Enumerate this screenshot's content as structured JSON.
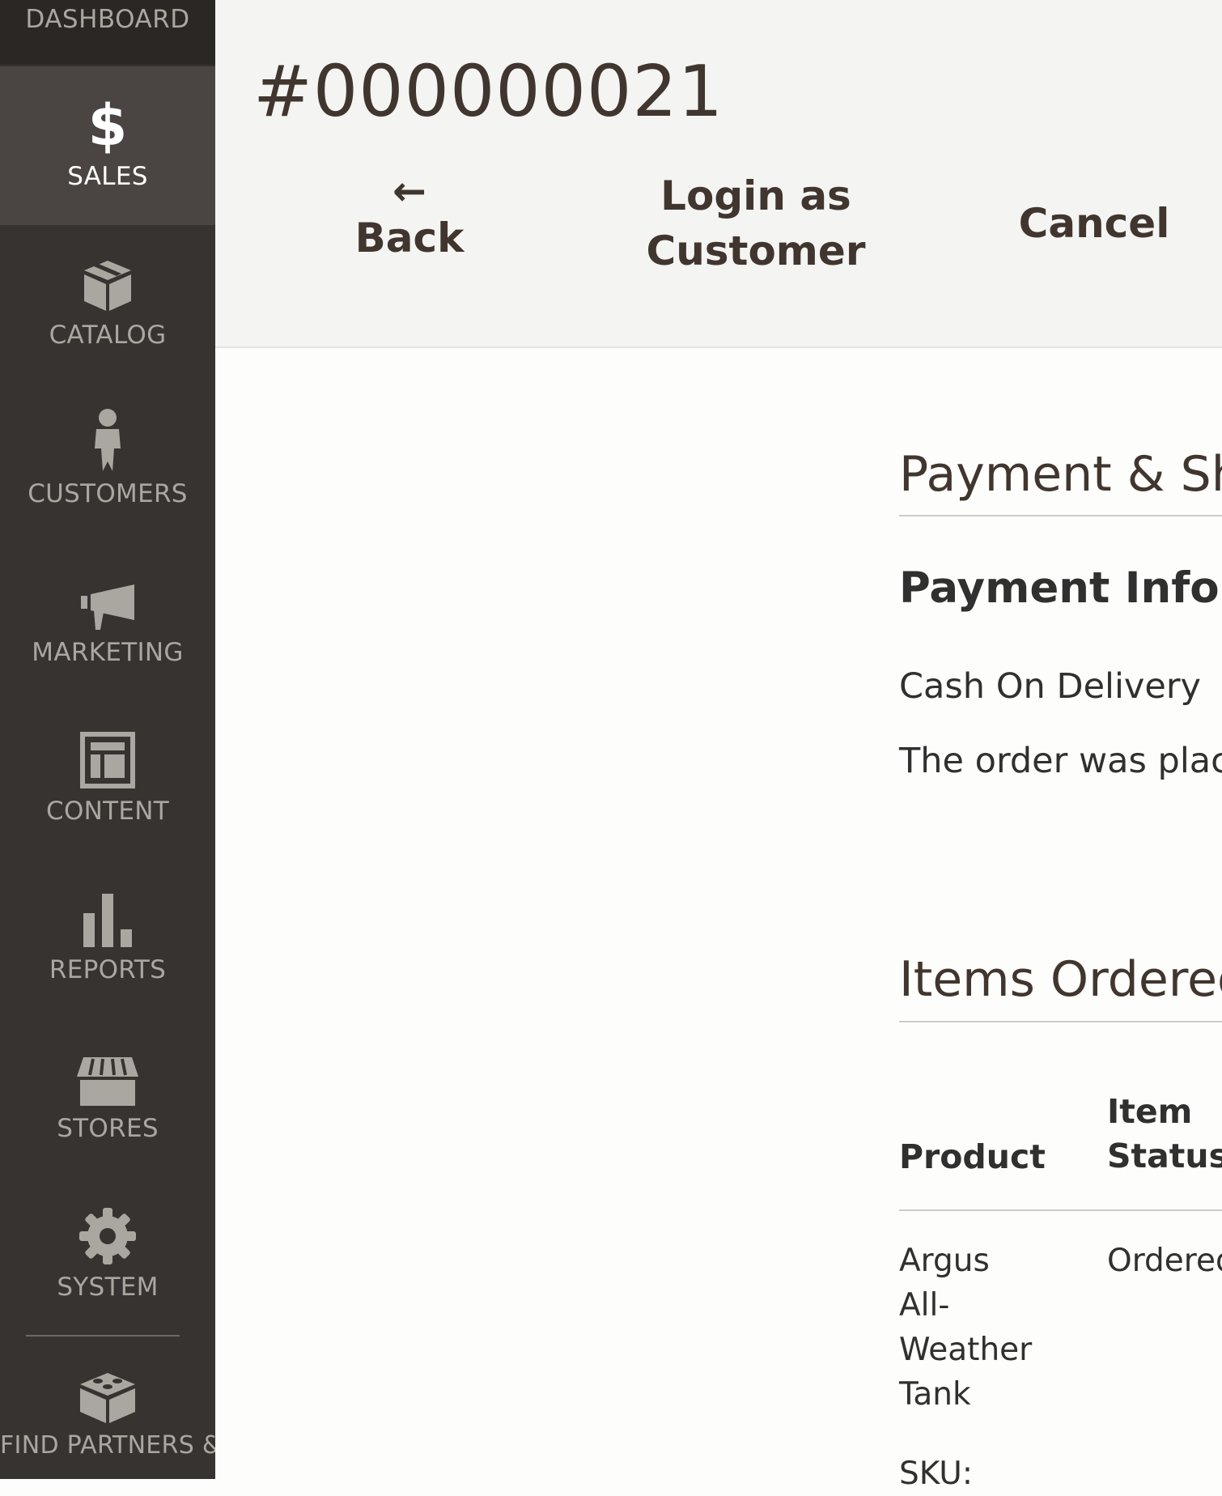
{
  "sidebar": {
    "top_label": "DASHBOARD",
    "items": [
      {
        "label": "SALES",
        "icon": "dollar-icon",
        "active": true
      },
      {
        "label": "CATALOG",
        "icon": "box-icon"
      },
      {
        "label": "CUSTOMERS",
        "icon": "person-icon"
      },
      {
        "label": "MARKETING",
        "icon": "megaphone-icon"
      },
      {
        "label": "CONTENT",
        "icon": "layout-icon"
      },
      {
        "label": "REPORTS",
        "icon": "bar-chart-icon"
      },
      {
        "label": "STORES",
        "icon": "storefront-icon"
      },
      {
        "label": "SYSTEM",
        "icon": "gear-icon"
      },
      {
        "label": "FIND PARTNERS & EXTENSIONS",
        "icon": "blocks-icon"
      }
    ],
    "dollar_glyph": "$"
  },
  "header": {
    "title": "#000000021",
    "back_arrow": "←",
    "back_label": "Back",
    "login_label_1": "Login as",
    "login_label_2": "Customer",
    "cancel_label": "Cancel"
  },
  "payment_section": {
    "title": "Payment & Sh",
    "subtitle": "Payment Infor",
    "method": "Cash On Delivery",
    "note": "The order was place"
  },
  "items_section": {
    "title": "Items Ordered",
    "columns": {
      "product": "Product",
      "item_status_1": "Item",
      "item_status_2": "Status"
    },
    "rows": [
      {
        "product_lines": [
          "Argus",
          "All-",
          "Weather",
          "Tank"
        ],
        "status": "Ordered",
        "sku_label": "SKU:"
      }
    ]
  },
  "colors": {
    "sidebar_bg": "#373330",
    "sidebar_active": "#4a4542",
    "header_bg": "#f4f4f2",
    "heading": "#41362f"
  }
}
